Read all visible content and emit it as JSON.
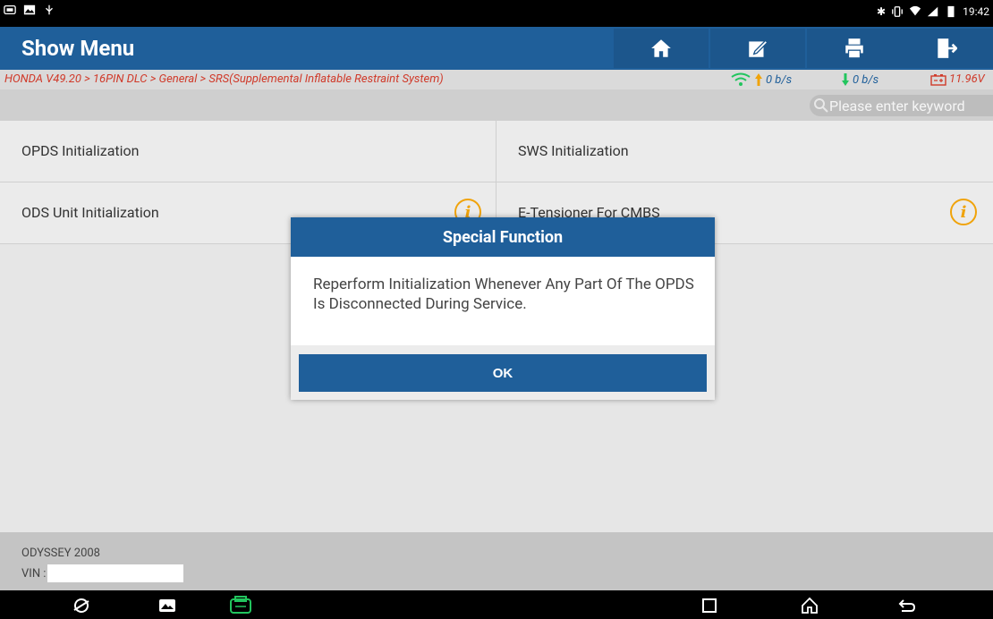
{
  "status_bar": {
    "time": "19:42",
    "left_icons": [
      "vci-icon",
      "image-icon",
      "usb-icon"
    ],
    "right_icons": [
      "bluetooth-icon",
      "vibrate-icon",
      "wifi-icon",
      "signal-icon",
      "battery-icon"
    ]
  },
  "header": {
    "title": "Show Menu",
    "buttons": [
      "home-icon",
      "edit-report-icon",
      "print-icon",
      "exit-icon"
    ]
  },
  "breadcrumb": {
    "path": "HONDA V49.20 > 16PIN DLC > General > SRS(Supplemental Inflatable Restraint System)",
    "upload": "0 b/s",
    "download": "0 b/s",
    "voltage": "11.96V"
  },
  "search": {
    "placeholder": "Please enter keyword"
  },
  "menu": {
    "items": [
      {
        "label": "OPDS Initialization",
        "has_info": false
      },
      {
        "label": "SWS Initialization",
        "has_info": false
      },
      {
        "label": "ODS Unit Initialization",
        "has_info": true
      },
      {
        "label": "E-Tensioner For CMBS",
        "has_info": true
      }
    ]
  },
  "footer": {
    "model": "ODYSSEY 2008",
    "vin_label": "VIN :"
  },
  "dialog": {
    "title": "Special Function",
    "message": "Reperform Initialization Whenever Any Part Of The OPDS Is Disconnected During Service.",
    "ok_label": "OK"
  },
  "nav_bar": {
    "icons": [
      "browser-icon",
      "gallery-icon",
      "vci-app-icon",
      "recents-icon",
      "home-nav-icon",
      "back-icon"
    ]
  },
  "colors": {
    "header_blue": "#1f5f9a",
    "breadcrumb_red": "#d03a2a",
    "info_orange": "#f0a30a",
    "green": "#22c55e"
  }
}
